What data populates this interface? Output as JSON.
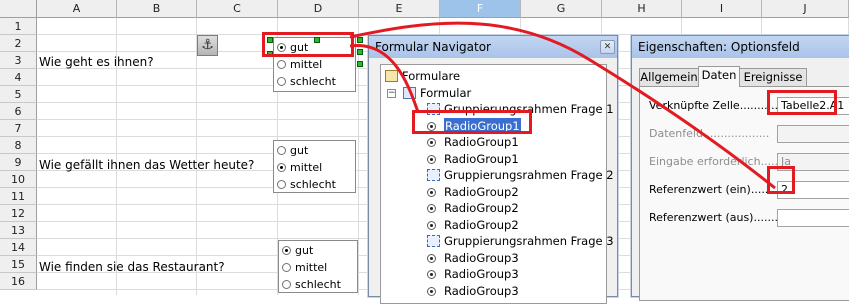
{
  "sheet": {
    "columns": [
      "A",
      "B",
      "C",
      "D",
      "E",
      "F",
      "G",
      "H",
      "I",
      "J"
    ],
    "selected_column": "F",
    "rows": [
      "1",
      "2",
      "3",
      "4",
      "5",
      "6",
      "7",
      "8",
      "9",
      "10",
      "11",
      "12",
      "13",
      "14",
      "15",
      "16"
    ],
    "questions": [
      "Wie geht es ihnen?",
      "Wie gefällt ihnen das Wetter heute?",
      "Wie finden sie das Restaurant?"
    ],
    "groups": [
      {
        "options": [
          "gut",
          "mittel",
          "schlecht"
        ],
        "checked": "gut"
      },
      {
        "options": [
          "gut",
          "mittel",
          "schlecht"
        ],
        "checked": "mittel"
      },
      {
        "options": [
          "gut",
          "mittel",
          "schlecht"
        ],
        "checked": "gut"
      }
    ],
    "anchor_icon": "anchor-icon",
    "anchor_glyph": "⚓"
  },
  "navigator": {
    "title": "Formular Navigator",
    "close_glyph": "✕",
    "tree": [
      {
        "label": "Formulare",
        "icon": "forms-folder-icon",
        "level": 0
      },
      {
        "label": "Formular",
        "icon": "form-icon",
        "level": 1,
        "expander": "−"
      },
      {
        "label": "Gruppierungsrahmen Frage 1",
        "icon": "group-frame-icon",
        "level": 2
      },
      {
        "label": "RadioGroup1",
        "icon": "radio-button-icon",
        "level": 2,
        "selected": true
      },
      {
        "label": "RadioGroup1",
        "icon": "radio-button-icon",
        "level": 2
      },
      {
        "label": "RadioGroup1",
        "icon": "radio-button-icon",
        "level": 2
      },
      {
        "label": "Gruppierungsrahmen Frage 2",
        "icon": "group-frame-icon",
        "level": 2
      },
      {
        "label": "RadioGroup2",
        "icon": "radio-button-icon",
        "level": 2
      },
      {
        "label": "RadioGroup2",
        "icon": "radio-button-icon",
        "level": 2
      },
      {
        "label": "RadioGroup2",
        "icon": "radio-button-icon",
        "level": 2
      },
      {
        "label": "Gruppierungsrahmen Frage 3",
        "icon": "group-frame-icon",
        "level": 2
      },
      {
        "label": "RadioGroup3",
        "icon": "radio-button-icon",
        "level": 2
      },
      {
        "label": "RadioGroup3",
        "icon": "radio-button-icon",
        "level": 2
      },
      {
        "label": "RadioGroup3",
        "icon": "radio-button-icon",
        "level": 2
      }
    ]
  },
  "properties": {
    "title": "Eigenschaften: Optionsfeld",
    "tabs": [
      "Allgemein",
      "Daten",
      "Ereignisse"
    ],
    "active_tab": "Daten",
    "fields": [
      {
        "label": "Verknüpfte Zelle.............",
        "value": "Tabelle2.A1",
        "dim": false
      },
      {
        "label": "Datenfeld...................",
        "value": "",
        "dim": true
      },
      {
        "label": "Eingabe erforderlich.......",
        "value": "Ja",
        "dim": true
      },
      {
        "label": "Referenzwert (ein)..........",
        "value": "2",
        "dim": false
      },
      {
        "label": "Referenzwert (aus)..........",
        "value": "",
        "dim": false
      }
    ]
  },
  "colors": {
    "annotation_red": "#e21b22",
    "selection_blue": "#3a6ecf",
    "dialog_title": "#b6ccec"
  }
}
